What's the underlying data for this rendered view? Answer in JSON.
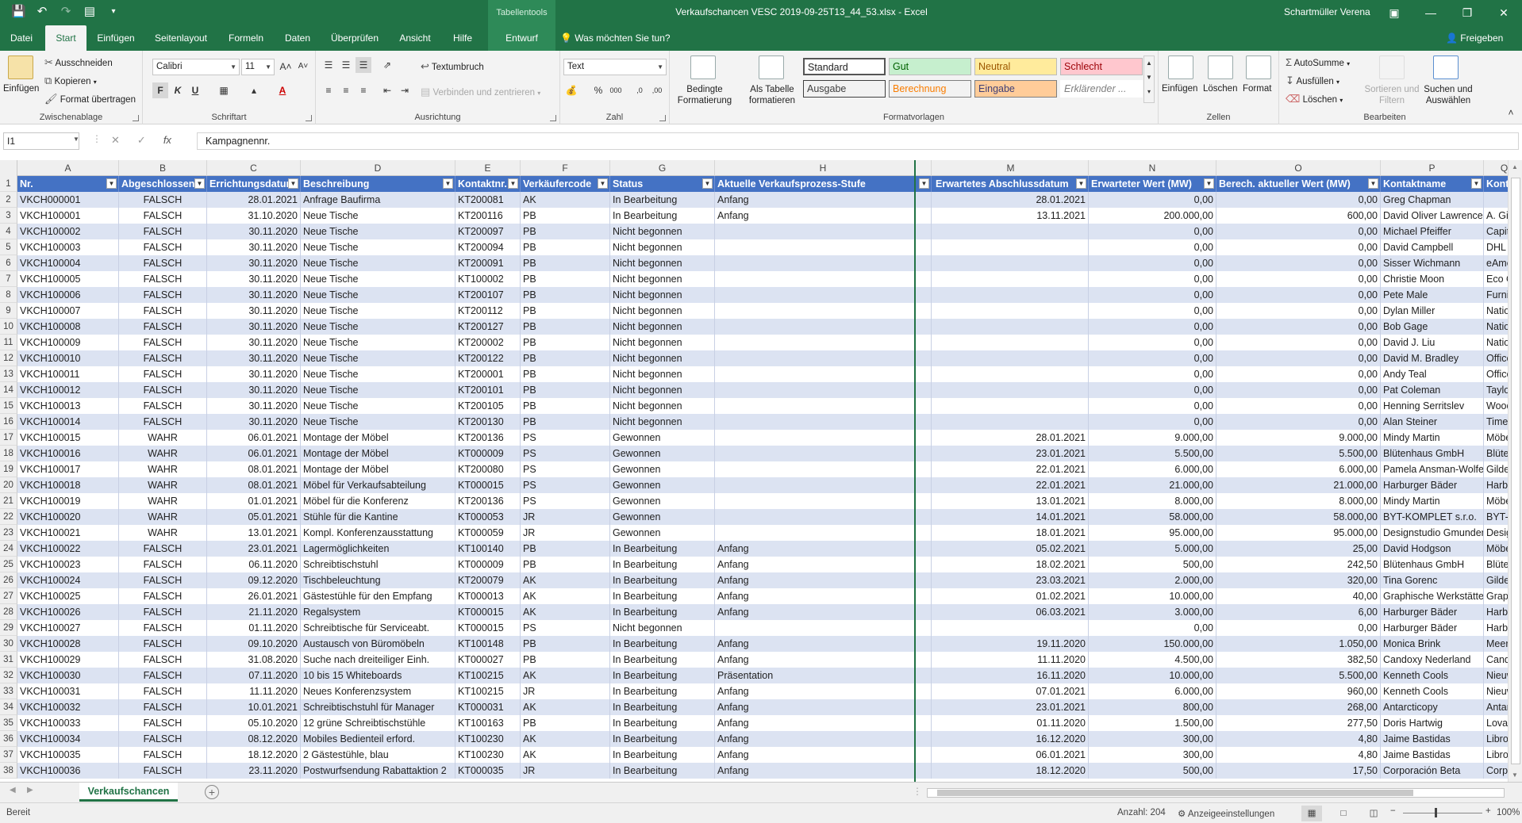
{
  "titlebar": {
    "doc_title": "Verkaufschancen VESC 2019-09-25T13_44_53.xlsx  -  Excel",
    "context_tools": "Tabellentools",
    "user": "Schartmüller Verena"
  },
  "tabs": [
    "Datei",
    "Start",
    "Einfügen",
    "Seitenlayout",
    "Formeln",
    "Daten",
    "Überprüfen",
    "Ansicht",
    "Hilfe",
    "Entwurf"
  ],
  "tell_me": "Was möchten Sie tun?",
  "share": "Freigeben",
  "ribbon": {
    "clipboard": {
      "paste": "Einfügen",
      "cut": "Ausschneiden",
      "copy": "Kopieren",
      "format_painter": "Format übertragen",
      "label": "Zwischenablage"
    },
    "font": {
      "name": "Calibri",
      "size": "11",
      "label": "Schriftart"
    },
    "alignment": {
      "wrap": "Textumbruch",
      "merge": "Verbinden und zentrieren",
      "label": "Ausrichtung"
    },
    "number": {
      "format": "Text",
      "label": "Zahl"
    },
    "styles": {
      "conditional": "Bedingte Formatierung",
      "as_table": "Als Tabelle formatieren",
      "cells": [
        "Standard",
        "Gut",
        "Neutral",
        "Schlecht",
        "Ausgabe",
        "Berechnung",
        "Eingabe",
        "Erklärender ..."
      ],
      "label": "Formatvorlagen"
    },
    "cells": {
      "insert": "Einfügen",
      "delete": "Löschen",
      "format": "Format",
      "label": "Zellen"
    },
    "editing": {
      "autosum": "AutoSumme",
      "fill": "Ausfüllen",
      "clear": "Löschen",
      "sort": "Sortieren und Filtern",
      "find": "Suchen und Auswählen",
      "label": "Bearbeiten"
    }
  },
  "formula_bar": {
    "name_box": "I1",
    "content": "Kampagnennr."
  },
  "columns": [
    "A",
    "B",
    "C",
    "D",
    "E",
    "F",
    "G",
    "H",
    "M",
    "N",
    "O",
    "P",
    "Q"
  ],
  "headers": [
    "Nr.",
    "Abgeschlossen",
    "Errichtungsdatum",
    "Beschreibung",
    "Kontaktnr.",
    "Verkäufercode",
    "Status",
    "Aktuelle Verkaufsprozess-Stufe",
    "Erwartetes Abschlussdatum",
    "Erwarteter Wert (MW)",
    "Berech. aktueller Wert (MW)",
    "Kontaktname",
    "Kontakt Un"
  ],
  "rows": [
    [
      "VKCH000001",
      "FALSCH",
      "28.01.2021",
      "Anfrage Baufirma",
      "KT200081",
      "AK",
      "In Bearbeitung",
      "Anfang",
      "28.01.2021",
      "0,00",
      "0,00",
      "Greg Chapman",
      ""
    ],
    [
      "VKCH100001",
      "FALSCH",
      "31.10.2020",
      "Neue Tische",
      "KT200116",
      "PB",
      "In Bearbeitung",
      "Anfang",
      "13.11.2021",
      "200.000,00",
      "600,00",
      "David Oliver Lawrence",
      "A. Gibson\"s"
    ],
    [
      "VKCH100002",
      "FALSCH",
      "30.11.2020",
      "Neue Tische",
      "KT200097",
      "PB",
      "Nicht begonnen",
      "",
      "",
      "0,00",
      "0,00",
      "Michael Pfeiffer",
      "Capital Offi"
    ],
    [
      "VKCH100003",
      "FALSCH",
      "30.11.2020",
      "Neue Tische",
      "KT200094",
      "PB",
      "Nicht begonnen",
      "",
      "",
      "0,00",
      "0,00",
      "David Campbell",
      "DHL Expres"
    ],
    [
      "VKCH100004",
      "FALSCH",
      "30.11.2020",
      "Neue Tische",
      "KT200091",
      "PB",
      "Nicht begonnen",
      "",
      "",
      "0,00",
      "0,00",
      "Sisser Wichmann",
      "eAmericon"
    ],
    [
      "VKCH100005",
      "FALSCH",
      "30.11.2020",
      "Neue Tische",
      "KT100002",
      "PB",
      "Nicht begonnen",
      "",
      "",
      "0,00",
      "0,00",
      "Christie Moon",
      "Eco Office I"
    ],
    [
      "VKCH100006",
      "FALSCH",
      "30.11.2020",
      "Neue Tische",
      "KT200107",
      "PB",
      "Nicht begonnen",
      "",
      "",
      "0,00",
      "0,00",
      "Pete Male",
      "Furnitures A"
    ],
    [
      "VKCH100007",
      "FALSCH",
      "30.11.2020",
      "Neue Tische",
      "KT200112",
      "PB",
      "Nicht begonnen",
      "",
      "",
      "0,00",
      "0,00",
      "Dylan Miller",
      "National W"
    ],
    [
      "VKCH100008",
      "FALSCH",
      "30.11.2020",
      "Neue Tische",
      "KT200127",
      "PB",
      "Nicht begonnen",
      "",
      "",
      "0,00",
      "0,00",
      "Bob Gage",
      "National W"
    ],
    [
      "VKCH100009",
      "FALSCH",
      "30.11.2020",
      "Neue Tische",
      "KT200002",
      "PB",
      "Nicht begonnen",
      "",
      "",
      "0,00",
      "0,00",
      "David J. Liu",
      "National W"
    ],
    [
      "VKCH100010",
      "FALSCH",
      "30.11.2020",
      "Neue Tische",
      "KT200122",
      "PB",
      "Nicht begonnen",
      "",
      "",
      "0,00",
      "0,00",
      "David M. Bradley",
      "Officeland I"
    ],
    [
      "VKCH100011",
      "FALSCH",
      "30.11.2020",
      "Neue Tische",
      "KT200001",
      "PB",
      "Nicht begonnen",
      "",
      "",
      "0,00",
      "0,00",
      "Andy Teal",
      "Officeland I"
    ],
    [
      "VKCH100012",
      "FALSCH",
      "30.11.2020",
      "Neue Tische",
      "KT200101",
      "PB",
      "Nicht begonnen",
      "",
      "",
      "0,00",
      "0,00",
      "Pat Coleman",
      "Taylor\"s Off"
    ],
    [
      "VKCH100013",
      "FALSCH",
      "30.11.2020",
      "Neue Tische",
      "KT200105",
      "PB",
      "Nicht begonnen",
      "",
      "",
      "0,00",
      "0,00",
      "Henning Serritslev",
      "Woodimex"
    ],
    [
      "VKCH100014",
      "FALSCH",
      "30.11.2020",
      "Neue Tische",
      "KT200130",
      "PB",
      "Nicht begonnen",
      "",
      "",
      "0,00",
      "0,00",
      "Alan Steiner",
      "Timeless Re"
    ],
    [
      "VKCH100015",
      "WAHR",
      "06.01.2021",
      "Montage der Möbel",
      "KT200136",
      "PS",
      "Gewonnen",
      "",
      "28.01.2021",
      "9.000,00",
      "9.000,00",
      "Mindy Martin",
      "Möbel-Mel"
    ],
    [
      "VKCH100016",
      "WAHR",
      "06.01.2021",
      "Montage der Möbel",
      "KT000009",
      "PS",
      "Gewonnen",
      "",
      "23.01.2021",
      "5.500,00",
      "5.500,00",
      "Blütenhaus GmbH",
      "Blütenhaus"
    ],
    [
      "VKCH100017",
      "WAHR",
      "08.01.2021",
      "Montage der Möbel",
      "KT200080",
      "PS",
      "Gewonnen",
      "",
      "22.01.2021",
      "6.000,00",
      "6.000,00",
      "Pamela Ansman-Wolfe",
      "Gilde Jupite"
    ],
    [
      "VKCH100018",
      "WAHR",
      "08.01.2021",
      "Möbel für Verkaufsabteilung",
      "KT000015",
      "PS",
      "Gewonnen",
      "",
      "22.01.2021",
      "21.000,00",
      "21.000,00",
      "Harburger Bäder",
      "Harburger B"
    ],
    [
      "VKCH100019",
      "WAHR",
      "01.01.2021",
      "Möbel für die Konferenz",
      "KT200136",
      "PS",
      "Gewonnen",
      "",
      "13.01.2021",
      "8.000,00",
      "8.000,00",
      "Mindy Martin",
      "Möbel-Mel"
    ],
    [
      "VKCH100020",
      "WAHR",
      "05.01.2021",
      "Stühle für die Kantine",
      "KT000053",
      "JR",
      "Gewonnen",
      "",
      "14.01.2021",
      "58.000,00",
      "58.000,00",
      "BYT-KOMPLET s.r.o.",
      "BYT-KOMPL"
    ],
    [
      "VKCH100021",
      "WAHR",
      "13.01.2021",
      "Kompl. Konferenzausstattung",
      "KT000059",
      "JR",
      "Gewonnen",
      "",
      "18.01.2021",
      "95.000,00",
      "95.000,00",
      "Designstudio Gmunden",
      "Designstud"
    ],
    [
      "VKCH100022",
      "FALSCH",
      "23.01.2021",
      "Lagermöglichkeiten",
      "KT100140",
      "PB",
      "In Bearbeitung",
      "Anfang",
      "05.02.2021",
      "5.000,00",
      "25,00",
      "David Hodgson",
      "Möbel-Mel"
    ],
    [
      "VKCH100023",
      "FALSCH",
      "06.11.2020",
      "Schreibtischstuhl",
      "KT000009",
      "PB",
      "In Bearbeitung",
      "Anfang",
      "18.02.2021",
      "500,00",
      "242,50",
      "Blütenhaus GmbH",
      "Blütenhaus"
    ],
    [
      "VKCH100024",
      "FALSCH",
      "09.12.2020",
      "Tischbeleuchtung",
      "KT200079",
      "AK",
      "In Bearbeitung",
      "Anfang",
      "23.03.2021",
      "2.000,00",
      "320,00",
      "Tina Gorenc",
      "Gilde Jupite"
    ],
    [
      "VKCH100025",
      "FALSCH",
      "26.01.2021",
      "Gästestühle für den Empfang",
      "KT000013",
      "AK",
      "In Bearbeitung",
      "Anfang",
      "01.02.2021",
      "10.000,00",
      "40,00",
      "Graphische Werkstätten",
      "Graphische"
    ],
    [
      "VKCH100026",
      "FALSCH",
      "21.11.2020",
      "Regalsystem",
      "KT000015",
      "AK",
      "In Bearbeitung",
      "Anfang",
      "06.03.2021",
      "3.000,00",
      "6,00",
      "Harburger Bäder",
      "Harburger B"
    ],
    [
      "VKCH100027",
      "FALSCH",
      "01.11.2020",
      "Schreibtische für Serviceabt.",
      "KT000015",
      "PS",
      "Nicht begonnen",
      "",
      "",
      "0,00",
      "0,00",
      "Harburger Bäder",
      "Harburger B"
    ],
    [
      "VKCH100028",
      "FALSCH",
      "09.10.2020",
      "Austausch von Büromöbeln",
      "KT100148",
      "PB",
      "In Bearbeitung",
      "Anfang",
      "19.11.2020",
      "150.000,00",
      "1.050,00",
      "Monica Brink",
      "Meersen M"
    ],
    [
      "VKCH100029",
      "FALSCH",
      "31.08.2020",
      "Suche nach dreiteiliger Einh.",
      "KT000027",
      "PB",
      "In Bearbeitung",
      "Anfang",
      "11.11.2020",
      "4.500,00",
      "382,50",
      "Candoxy Nederland",
      "Candoxy Ne"
    ],
    [
      "VKCH100030",
      "FALSCH",
      "07.11.2020",
      "10 bis 15 Whiteboards",
      "KT100215",
      "AK",
      "In Bearbeitung",
      "Präsentation",
      "16.11.2020",
      "10.000,00",
      "5.500,00",
      "Kenneth Cools",
      "Nieuwe Zar"
    ],
    [
      "VKCH100031",
      "FALSCH",
      "11.11.2020",
      "Neues Konferenzsystem",
      "KT100215",
      "JR",
      "In Bearbeitung",
      "Anfang",
      "07.01.2021",
      "6.000,00",
      "960,00",
      "Kenneth Cools",
      "Nieuwe Zar"
    ],
    [
      "VKCH100032",
      "FALSCH",
      "10.01.2021",
      "Schreibtischstuhl für Manager",
      "KT000031",
      "AK",
      "In Bearbeitung",
      "Anfang",
      "23.01.2021",
      "800,00",
      "268,00",
      "Antarcticopy",
      "Antarcticop"
    ],
    [
      "VKCH100033",
      "FALSCH",
      "05.10.2020",
      "12 grüne Schreibtischstühle",
      "KT100163",
      "PB",
      "In Bearbeitung",
      "Anfang",
      "01.11.2020",
      "1.500,00",
      "277,50",
      "Doris Hartwig",
      "Lovaina Cor"
    ],
    [
      "VKCH100034",
      "FALSCH",
      "08.12.2020",
      "Mobiles Bedienteil erford.",
      "KT100230",
      "AK",
      "In Bearbeitung",
      "Anfang",
      "16.12.2020",
      "300,00",
      "4,80",
      "Jaime Bastidas",
      "Libros S.A."
    ],
    [
      "VKCH100035",
      "FALSCH",
      "18.12.2020",
      "2 Gästestühle, blau",
      "KT100230",
      "AK",
      "In Bearbeitung",
      "Anfang",
      "06.01.2021",
      "300,00",
      "4,80",
      "Jaime Bastidas",
      "Libros S.A."
    ],
    [
      "VKCH100036",
      "FALSCH",
      "23.11.2020",
      "Postwurfsendung Rabattaktion 2",
      "KT000035",
      "JR",
      "In Bearbeitung",
      "Anfang",
      "18.12.2020",
      "500,00",
      "17,50",
      "Corporación Beta",
      "Corporació"
    ]
  ],
  "sheet_tab": "Verkaufschancen",
  "status": {
    "ready": "Bereit",
    "count": "Anzahl: 204",
    "display": "Anzeigeeinstellungen",
    "zoom": "100%"
  },
  "colors": {
    "accent": "#217346",
    "table_header": "#4472c4",
    "band": "#dce3f2"
  }
}
